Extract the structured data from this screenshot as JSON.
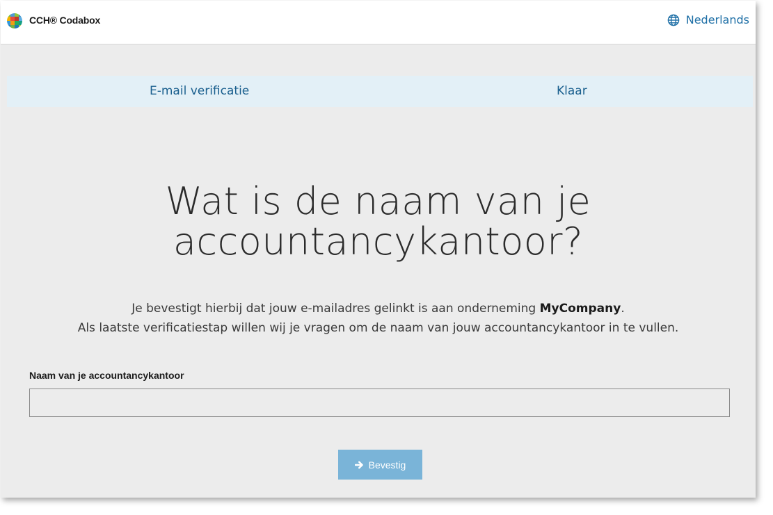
{
  "header": {
    "brand_label": "CCH® Codabox",
    "language_label": "Nederlands",
    "icons": [
      "logo-icon",
      "globe-icon"
    ]
  },
  "steps": [
    {
      "label": "E-mail verificatie"
    },
    {
      "label": "Klaar"
    }
  ],
  "main": {
    "title_line1": "Wat is de naam van je",
    "title_line2": "accountancykantoor?",
    "desc_line1_prefix": "Je bevestigt hierbij dat jouw e-mailadres gelinkt is aan onderneming ",
    "company_name": "MyCompany",
    "desc_line1_suffix": ".",
    "desc_line2": "Als laatste verificatiestap willen wij je vragen om de naam van jouw accountancykantoor in te vullen."
  },
  "form": {
    "field_label": "Naam van je accountancykantoor",
    "field_value": "",
    "submit_label": "Bevestig",
    "submit_icon": "arrow-right-icon"
  },
  "colors": {
    "accent": "#1e6fa6",
    "button": "#7ab4d8",
    "steps_bg": "#e3f0f7",
    "page_bg": "#ececec"
  }
}
